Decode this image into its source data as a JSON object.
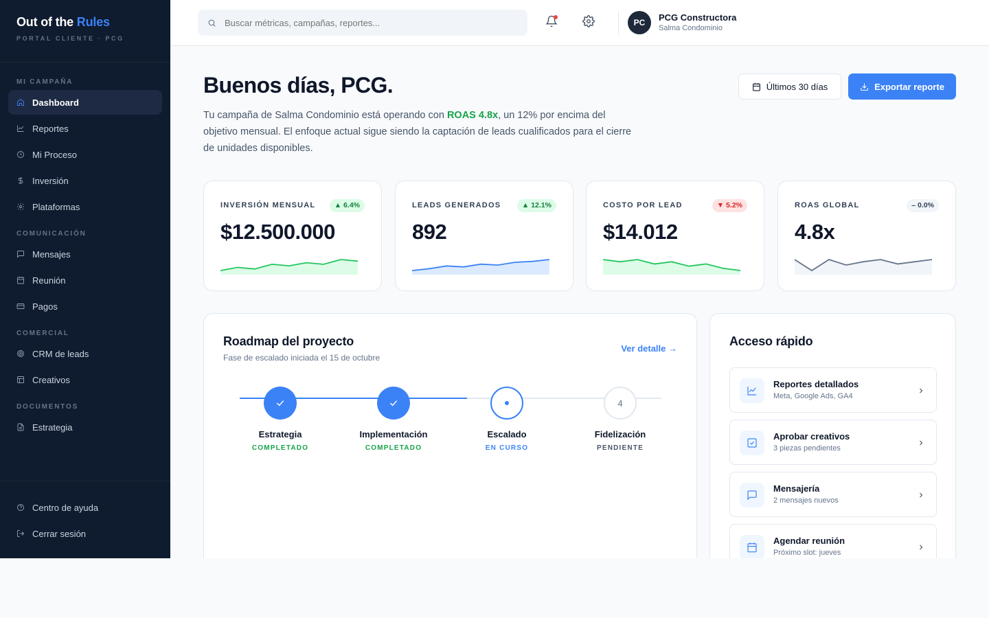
{
  "brand": {
    "title_main": "Out of the",
    "title_accent": "Rules",
    "subtitle": "PORTAL CLIENTE · PCG"
  },
  "sidebar": {
    "sections": [
      {
        "heading": "MI CAMPAÑA",
        "items": [
          {
            "label": "Dashboard",
            "icon": "home-icon",
            "active": true
          },
          {
            "label": "Reportes",
            "icon": "chart-line-icon"
          },
          {
            "label": "Mi Proceso",
            "icon": "clock-icon"
          },
          {
            "label": "Inversión",
            "icon": "dollar-icon"
          },
          {
            "label": "Plataformas",
            "icon": "gear-icon"
          }
        ]
      },
      {
        "heading": "COMUNICACIÓN",
        "items": [
          {
            "label": "Mensajes",
            "icon": "message-icon"
          },
          {
            "label": "Reunión",
            "icon": "calendar-icon"
          },
          {
            "label": "Pagos",
            "icon": "credit-card-icon"
          }
        ]
      },
      {
        "heading": "COMERCIAL",
        "items": [
          {
            "label": "CRM de leads",
            "icon": "target-icon"
          },
          {
            "label": "Creativos",
            "icon": "image-icon"
          }
        ]
      },
      {
        "heading": "DOCUMENTOS",
        "items": [
          {
            "label": "Estrategia",
            "icon": "document-icon"
          }
        ]
      }
    ],
    "bottom": [
      {
        "label": "Centro de ayuda",
        "icon": "help-icon"
      },
      {
        "label": "Cerrar sesión",
        "icon": "logout-icon"
      }
    ]
  },
  "topbar": {
    "search_placeholder": "Buscar métricas, campañas, reportes...",
    "user_initials": "PC",
    "user_name": "PCG Constructora",
    "user_project": "Salma Condominio"
  },
  "main": {
    "greeting": "Buenos días, PCG.",
    "intro_before": "Tu campaña de Salma Condominio está operando con ",
    "intro_roas": "ROAS 4.8x",
    "intro_after": ", un 12% por encima del objetivo mensual. El enfoque actual sigue siendo la captación de leads cualificados para el cierre de unidades disponibles.",
    "range_button": "Últimos 30 días",
    "export_button": "Exportar reporte"
  },
  "kpis": [
    {
      "label": "INVERSIÓN MENSUAL",
      "badge": "▲ 6.4%",
      "trend": "up",
      "value": "$12.500.000",
      "color": "#22c55e",
      "fill": "#dcfce7",
      "spark": [
        3,
        5,
        4,
        7,
        6,
        8,
        7,
        10,
        9
      ]
    },
    {
      "label": "LEADS GENERADOS",
      "badge": "▲ 12.1%",
      "trend": "up",
      "value": "892",
      "color": "#3b82f6",
      "fill": "#dbeafe",
      "spark": [
        2,
        4,
        7,
        6,
        9,
        8,
        11,
        12,
        14
      ]
    },
    {
      "label": "COSTO POR LEAD",
      "badge": "▼ 5.2%",
      "trend": "down",
      "value": "$14.012",
      "color": "#22c55e",
      "fill": "#dcfce7",
      "spark": [
        10,
        9,
        10,
        8,
        9,
        7,
        8,
        6,
        5
      ]
    },
    {
      "label": "ROAS GLOBAL",
      "badge": "– 0.0%",
      "trend": "flat",
      "value": "4.8x",
      "color": "#64748b",
      "fill": "#f1f5f9",
      "spark": [
        6,
        5,
        6,
        5.5,
        5.8,
        6,
        5.6,
        5.8,
        6
      ]
    }
  ],
  "roadmap": {
    "title": "Roadmap del proyecto",
    "subtitle": "Fase de escalado iniciada el 15 de octubre",
    "link": "Ver detalle →",
    "steps": [
      {
        "name": "Estrategia",
        "status": "COMPLETADO",
        "state": "done",
        "number": "1"
      },
      {
        "name": "Implementación",
        "status": "COMPLETADO",
        "state": "done",
        "number": "2"
      },
      {
        "name": "Escalado",
        "status": "EN CURSO",
        "state": "current",
        "number": "3"
      },
      {
        "name": "Fidelización",
        "status": "PENDIENTE",
        "state": "pending",
        "number": "4"
      }
    ]
  },
  "quick_access": {
    "title": "Acceso rápido",
    "items": [
      {
        "title": "Reportes detallados",
        "subtitle": "Meta, Google Ads, GA4",
        "icon": "chart-line-icon"
      },
      {
        "title": "Aprobar creativos",
        "subtitle": "3 piezas pendientes",
        "icon": "check-square-icon"
      },
      {
        "title": "Mensajería",
        "subtitle": "2 mensajes nuevos",
        "icon": "message-icon"
      },
      {
        "title": "Agendar reunión",
        "subtitle": "Próximo slot: jueves",
        "icon": "calendar-icon"
      }
    ]
  },
  "colors": {
    "sidebar_bg": "#0f1b2e",
    "accent": "#3b82f6",
    "success": "#16a34a",
    "danger": "#dc2626"
  }
}
